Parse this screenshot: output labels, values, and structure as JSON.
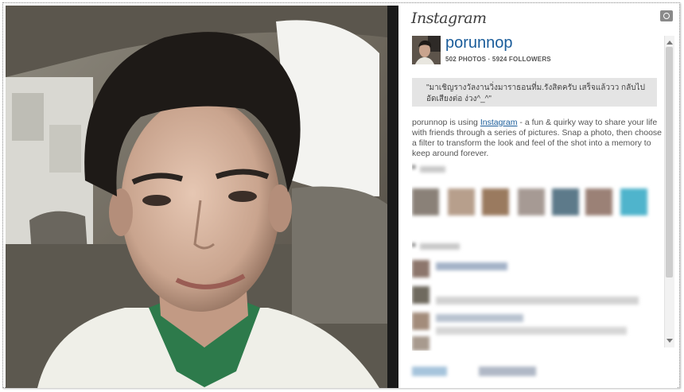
{
  "brand": {
    "logo": "Instagram"
  },
  "profile": {
    "username": "porunnop",
    "stats": "502 PHOTOS · 5924 FOLLOWERS",
    "bio": "\"มาเชิญรางวัลงานวิ่งมาราธอนที่ม.รังสิตครับ เสร็จแล้ววว กลับไปอัดเสียงต่อ ง่วง^_^\""
  },
  "description": {
    "before": "porunnop is using ",
    "link": "Instagram",
    "after": " - a fun & quirky way to share your life with friends through a series of pictures. Snap a photo, then choose a filter to transform the look and feel of the shot into a memory to keep around forever."
  },
  "icons": {
    "camera": "camera-icon",
    "scroll_up": "chevron-up-icon",
    "scroll_down": "chevron-down-icon"
  },
  "colors": {
    "link": "#1a5c9a",
    "bio_bg": "#e4e4e4",
    "divider": "#1a1a1a"
  },
  "images": {
    "main_photo": "selfie of young man in car back seat",
    "avatar": "profile photo"
  }
}
